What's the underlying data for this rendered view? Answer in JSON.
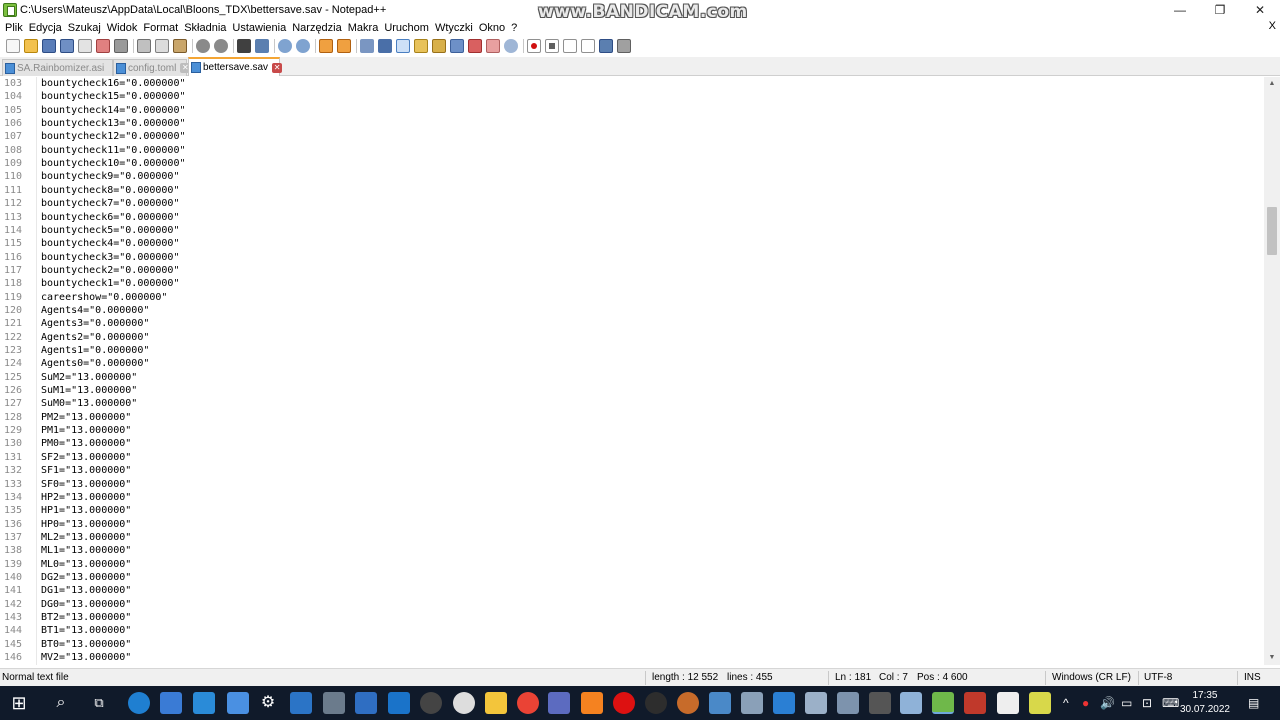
{
  "window": {
    "title": "C:\\Users\\Mateusz\\AppData\\Local\\Bloons_TDX\\bettersave.sav - Notepad++",
    "watermark": "www.BANDICAM.com",
    "minimize": "—",
    "maximize": "❐",
    "close": "✕"
  },
  "menu": {
    "items": [
      "Plik",
      "Edycja",
      "Szukaj",
      "Widok",
      "Format",
      "Składnia",
      "Ustawienia",
      "Narzędzia",
      "Makra",
      "Uruchom",
      "Wtyczki",
      "Okno",
      "?"
    ],
    "close_doc": "X"
  },
  "tabs": [
    {
      "label": "SA.Rainbomizer.asi",
      "active": false
    },
    {
      "label": "config.toml",
      "active": false
    },
    {
      "label": "bettersave.sav",
      "active": true
    }
  ],
  "editor": {
    "lines": [
      {
        "num": "103",
        "text": "bountycheck16=\"0.000000\""
      },
      {
        "num": "104",
        "text": "bountycheck15=\"0.000000\""
      },
      {
        "num": "105",
        "text": "bountycheck14=\"0.000000\""
      },
      {
        "num": "106",
        "text": "bountycheck13=\"0.000000\""
      },
      {
        "num": "107",
        "text": "bountycheck12=\"0.000000\""
      },
      {
        "num": "108",
        "text": "bountycheck11=\"0.000000\""
      },
      {
        "num": "109",
        "text": "bountycheck10=\"0.000000\""
      },
      {
        "num": "110",
        "text": "bountycheck9=\"0.000000\""
      },
      {
        "num": "111",
        "text": "bountycheck8=\"0.000000\""
      },
      {
        "num": "112",
        "text": "bountycheck7=\"0.000000\""
      },
      {
        "num": "113",
        "text": "bountycheck6=\"0.000000\""
      },
      {
        "num": "114",
        "text": "bountycheck5=\"0.000000\""
      },
      {
        "num": "115",
        "text": "bountycheck4=\"0.000000\""
      },
      {
        "num": "116",
        "text": "bountycheck3=\"0.000000\""
      },
      {
        "num": "117",
        "text": "bountycheck2=\"0.000000\""
      },
      {
        "num": "118",
        "text": "bountycheck1=\"0.000000\""
      },
      {
        "num": "119",
        "text": "careershow=\"0.000000\""
      },
      {
        "num": "120",
        "text": "Agents4=\"0.000000\""
      },
      {
        "num": "121",
        "text": "Agents3=\"0.000000\""
      },
      {
        "num": "122",
        "text": "Agents2=\"0.000000\""
      },
      {
        "num": "123",
        "text": "Agents1=\"0.000000\""
      },
      {
        "num": "124",
        "text": "Agents0=\"0.000000\""
      },
      {
        "num": "125",
        "text": "SuM2=\"13.000000\""
      },
      {
        "num": "126",
        "text": "SuM1=\"13.000000\""
      },
      {
        "num": "127",
        "text": "SuM0=\"13.000000\""
      },
      {
        "num": "128",
        "text": "PM2=\"13.000000\""
      },
      {
        "num": "129",
        "text": "PM1=\"13.000000\""
      },
      {
        "num": "130",
        "text": "PM0=\"13.000000\""
      },
      {
        "num": "131",
        "text": "SF2=\"13.000000\""
      },
      {
        "num": "132",
        "text": "SF1=\"13.000000\""
      },
      {
        "num": "133",
        "text": "SF0=\"13.000000\""
      },
      {
        "num": "134",
        "text": "HP2=\"13.000000\""
      },
      {
        "num": "135",
        "text": "HP1=\"13.000000\""
      },
      {
        "num": "136",
        "text": "HP0=\"13.000000\""
      },
      {
        "num": "137",
        "text": "ML2=\"13.000000\""
      },
      {
        "num": "138",
        "text": "ML1=\"13.000000\""
      },
      {
        "num": "139",
        "text": "ML0=\"13.000000\""
      },
      {
        "num": "140",
        "text": "DG2=\"13.000000\""
      },
      {
        "num": "141",
        "text": "DG1=\"13.000000\""
      },
      {
        "num": "142",
        "text": "DG0=\"13.000000\""
      },
      {
        "num": "143",
        "text": "BT2=\"13.000000\""
      },
      {
        "num": "144",
        "text": "BT1=\"13.000000\""
      },
      {
        "num": "145",
        "text": "BT0=\"13.000000\""
      },
      {
        "num": "146",
        "text": "MV2=\"13.000000\""
      }
    ]
  },
  "statusbar": {
    "file_type": "Normal text file",
    "length": "length : 12 552",
    "lines": "lines : 455",
    "ln": "Ln : 181",
    "col": "Col : 7",
    "pos": "Pos : 4 600",
    "eol": "Windows (CR LF)",
    "encoding": "UTF-8",
    "mode": "INS"
  },
  "taskbar": {
    "time": "17:35",
    "date": "30.07.2022"
  },
  "colors": {
    "accent_tab": "#f4a534",
    "taskbar_bg": "#101a2a",
    "line_numbers": "#8a8a8a"
  }
}
